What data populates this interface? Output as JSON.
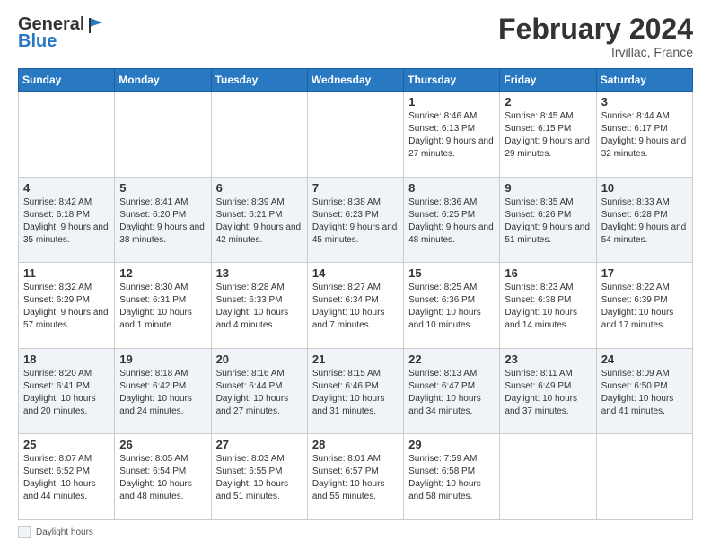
{
  "header": {
    "logo_line1": "General",
    "logo_line2": "Blue",
    "month_title": "February 2024",
    "location": "Irvillac, France"
  },
  "footer": {
    "daylight_label": "Daylight hours"
  },
  "days_of_week": [
    "Sunday",
    "Monday",
    "Tuesday",
    "Wednesday",
    "Thursday",
    "Friday",
    "Saturday"
  ],
  "weeks": [
    [
      {
        "day": "",
        "info": ""
      },
      {
        "day": "",
        "info": ""
      },
      {
        "day": "",
        "info": ""
      },
      {
        "day": "",
        "info": ""
      },
      {
        "day": "1",
        "info": "Sunrise: 8:46 AM\nSunset: 6:13 PM\nDaylight: 9 hours and 27 minutes."
      },
      {
        "day": "2",
        "info": "Sunrise: 8:45 AM\nSunset: 6:15 PM\nDaylight: 9 hours and 29 minutes."
      },
      {
        "day": "3",
        "info": "Sunrise: 8:44 AM\nSunset: 6:17 PM\nDaylight: 9 hours and 32 minutes."
      }
    ],
    [
      {
        "day": "4",
        "info": "Sunrise: 8:42 AM\nSunset: 6:18 PM\nDaylight: 9 hours and 35 minutes."
      },
      {
        "day": "5",
        "info": "Sunrise: 8:41 AM\nSunset: 6:20 PM\nDaylight: 9 hours and 38 minutes."
      },
      {
        "day": "6",
        "info": "Sunrise: 8:39 AM\nSunset: 6:21 PM\nDaylight: 9 hours and 42 minutes."
      },
      {
        "day": "7",
        "info": "Sunrise: 8:38 AM\nSunset: 6:23 PM\nDaylight: 9 hours and 45 minutes."
      },
      {
        "day": "8",
        "info": "Sunrise: 8:36 AM\nSunset: 6:25 PM\nDaylight: 9 hours and 48 minutes."
      },
      {
        "day": "9",
        "info": "Sunrise: 8:35 AM\nSunset: 6:26 PM\nDaylight: 9 hours and 51 minutes."
      },
      {
        "day": "10",
        "info": "Sunrise: 8:33 AM\nSunset: 6:28 PM\nDaylight: 9 hours and 54 minutes."
      }
    ],
    [
      {
        "day": "11",
        "info": "Sunrise: 8:32 AM\nSunset: 6:29 PM\nDaylight: 9 hours and 57 minutes."
      },
      {
        "day": "12",
        "info": "Sunrise: 8:30 AM\nSunset: 6:31 PM\nDaylight: 10 hours and 1 minute."
      },
      {
        "day": "13",
        "info": "Sunrise: 8:28 AM\nSunset: 6:33 PM\nDaylight: 10 hours and 4 minutes."
      },
      {
        "day": "14",
        "info": "Sunrise: 8:27 AM\nSunset: 6:34 PM\nDaylight: 10 hours and 7 minutes."
      },
      {
        "day": "15",
        "info": "Sunrise: 8:25 AM\nSunset: 6:36 PM\nDaylight: 10 hours and 10 minutes."
      },
      {
        "day": "16",
        "info": "Sunrise: 8:23 AM\nSunset: 6:38 PM\nDaylight: 10 hours and 14 minutes."
      },
      {
        "day": "17",
        "info": "Sunrise: 8:22 AM\nSunset: 6:39 PM\nDaylight: 10 hours and 17 minutes."
      }
    ],
    [
      {
        "day": "18",
        "info": "Sunrise: 8:20 AM\nSunset: 6:41 PM\nDaylight: 10 hours and 20 minutes."
      },
      {
        "day": "19",
        "info": "Sunrise: 8:18 AM\nSunset: 6:42 PM\nDaylight: 10 hours and 24 minutes."
      },
      {
        "day": "20",
        "info": "Sunrise: 8:16 AM\nSunset: 6:44 PM\nDaylight: 10 hours and 27 minutes."
      },
      {
        "day": "21",
        "info": "Sunrise: 8:15 AM\nSunset: 6:46 PM\nDaylight: 10 hours and 31 minutes."
      },
      {
        "day": "22",
        "info": "Sunrise: 8:13 AM\nSunset: 6:47 PM\nDaylight: 10 hours and 34 minutes."
      },
      {
        "day": "23",
        "info": "Sunrise: 8:11 AM\nSunset: 6:49 PM\nDaylight: 10 hours and 37 minutes."
      },
      {
        "day": "24",
        "info": "Sunrise: 8:09 AM\nSunset: 6:50 PM\nDaylight: 10 hours and 41 minutes."
      }
    ],
    [
      {
        "day": "25",
        "info": "Sunrise: 8:07 AM\nSunset: 6:52 PM\nDaylight: 10 hours and 44 minutes."
      },
      {
        "day": "26",
        "info": "Sunrise: 8:05 AM\nSunset: 6:54 PM\nDaylight: 10 hours and 48 minutes."
      },
      {
        "day": "27",
        "info": "Sunrise: 8:03 AM\nSunset: 6:55 PM\nDaylight: 10 hours and 51 minutes."
      },
      {
        "day": "28",
        "info": "Sunrise: 8:01 AM\nSunset: 6:57 PM\nDaylight: 10 hours and 55 minutes."
      },
      {
        "day": "29",
        "info": "Sunrise: 7:59 AM\nSunset: 6:58 PM\nDaylight: 10 hours and 58 minutes."
      },
      {
        "day": "",
        "info": ""
      },
      {
        "day": "",
        "info": ""
      }
    ]
  ]
}
